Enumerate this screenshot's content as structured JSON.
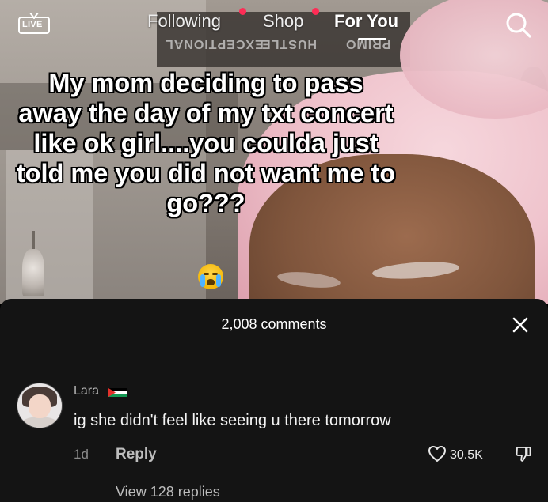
{
  "top_bar": {
    "live_label": "LIVE",
    "tabs": [
      {
        "label": "Following",
        "has_dot": true
      },
      {
        "label": "Shop",
        "has_dot": true
      },
      {
        "label": "For You",
        "active": true
      }
    ],
    "mirrored_watermark": [
      "EXCEPTIONAL",
      "HUSTLE",
      "PRIMO"
    ],
    "search_icon": "search-icon"
  },
  "video": {
    "caption": "My mom deciding to pass away the day of my txt concert like ok girl....you coulda just told me you did not want me to go???",
    "emoji": "loudly-crying-face"
  },
  "comments": {
    "count_label": "2,008 comments",
    "close_icon": "close-icon",
    "items": [
      {
        "author": "Lara",
        "flag": "palestine-flag",
        "text": "ig she didn't feel like seeing u there tomorrow",
        "age": "1d",
        "reply_label": "Reply",
        "likes": "30.5K",
        "view_replies_label": "View 128 replies"
      }
    ]
  },
  "colors": {
    "accent_dot": "#fe2c55",
    "sheet_bg": "#141414"
  }
}
